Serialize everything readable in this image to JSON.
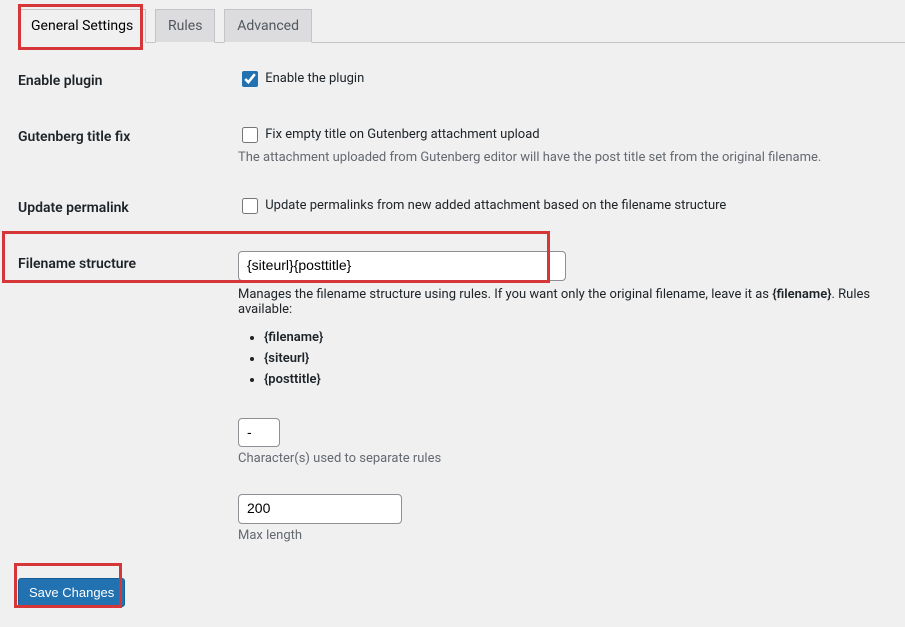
{
  "tabs": {
    "general": "General Settings",
    "rules": "Rules",
    "advanced": "Advanced"
  },
  "fields": {
    "enable_plugin": {
      "label": "Enable plugin",
      "cb_label": "Enable the plugin"
    },
    "gutenberg_fix": {
      "label": "Gutenberg title fix",
      "cb_label": "Fix empty title on Gutenberg attachment upload",
      "desc": "The attachment uploaded from Gutenberg editor will have the post title set from the original filename."
    },
    "update_permalink": {
      "label": "Update permalink",
      "cb_label": "Update permalinks from new added attachment based on the filename structure"
    },
    "filename_structure": {
      "label": "Filename structure",
      "value": "{siteurl}{posttitle}",
      "desc_prefix": "Manages the filename structure using rules. If you want only the original filename, leave it as ",
      "desc_bold": "{filename}",
      "desc_suffix": ". Rules available:",
      "rules": [
        "{filename}",
        "{siteurl}",
        "{posttitle}"
      ],
      "separator": {
        "value": "-",
        "desc": "Character(s) used to separate rules"
      },
      "maxlen": {
        "value": "200",
        "desc": "Max length"
      }
    }
  },
  "submit_label": "Save Changes"
}
